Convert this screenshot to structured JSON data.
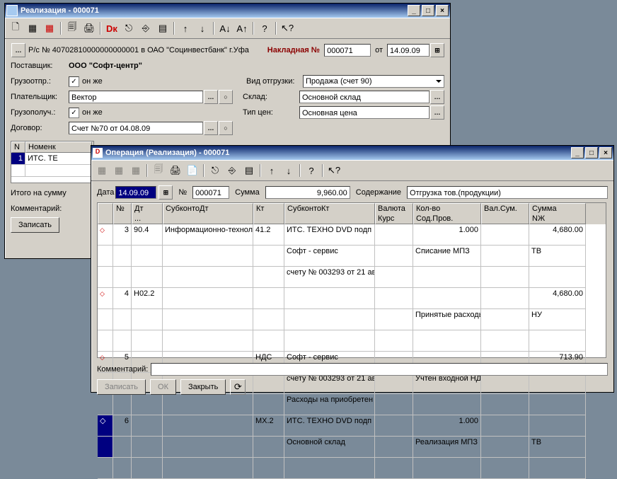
{
  "win1": {
    "title": "Реализация - 000071",
    "bank_line": "Р/с № 40702810000000000001 в ОАО \"Социнвестбанк\" г.Уфа",
    "invoice_label": "Накладная №",
    "invoice_no": "000071",
    "date_label": "от",
    "date": "14.09.09",
    "supplier_label": "Поставщик:",
    "supplier": "ООО \"Софт-центр\"",
    "shipper_label": "Грузоотпр.:",
    "same": "он же",
    "payer_label": "Плательщик:",
    "payer": "Вектор",
    "consignee_label": "Грузополуч.:",
    "contract_label": "Договор:",
    "contract": "Счет №70 от 04.08.09",
    "shiptype_label": "Вид отгрузки:",
    "shiptype": "Продажа (счет 90)",
    "warehouse_label": "Склад:",
    "warehouse": "Основной склад",
    "pricetype_label": "Тип цен:",
    "pricetype": "Основная цена",
    "grid_cols": {
      "n": "N",
      "nomenklatura": "Номенк"
    },
    "grid_row1_n": "1",
    "grid_row1_text": "ИТС. ТЕ",
    "total_label": "Итого на сумму",
    "comment_label": "Комментарий:",
    "save_btn": "Записать"
  },
  "win2": {
    "title": "Операция (Реализация) - 000071",
    "date_label": "Дата",
    "date": "14.09.09",
    "no_label": "№",
    "no": "000071",
    "sum_label": "Сумма",
    "sum": "9,960.00",
    "content_label": "Содержание",
    "content": "Отгрузка тов.(продукции)",
    "cols": {
      "mark": "",
      "n": "№",
      "dt": "Дт",
      "subdt": "СубконтоДт",
      "kt": "Кт",
      "subkt": "СубконтоКт",
      "curr": "Валюта",
      "rate": "Курс",
      "qty": "Кол-во",
      "sod": "Сод.Пров.",
      "valsum": "Вал.Сум.",
      "sum": "Сумма",
      "nzh": "NЖ"
    },
    "rows": [
      {
        "n": "3",
        "dt": "90.4",
        "subdt": "Информационно-технол",
        "kt": "41.2",
        "subkt1": "ИТС. ТЕХНО DVD подп",
        "subkt2": "Софт - сервис",
        "subkt3": "счету № 003293 от 21 ав",
        "qty": "1.000",
        "sod": "Списание МПЗ",
        "sum": "4,680.00",
        "nzh": "ТВ"
      },
      {
        "n": "4",
        "dt": "Н02.2",
        "subdt": "",
        "kt": "",
        "subkt1": "",
        "subkt2": "",
        "subkt3": "",
        "qty": "",
        "sod": "Принятые расходы",
        "sum": "4,680.00",
        "nzh": "НУ"
      },
      {
        "n": "5",
        "dt": "",
        "subdt": "",
        "kt": "НДС",
        "subkt1": "Софт - сервис",
        "subkt2": "счету № 003293 от 21 ав",
        "subkt3": "Расходы на приобретен",
        "qty": "",
        "sod": "Учтен входной НДС",
        "sum": "713.90",
        "nzh": ""
      },
      {
        "n": "6",
        "dt": "",
        "subdt": "",
        "kt": "МХ.2",
        "subkt1": "ИТС. ТЕХНО DVD подп",
        "subkt2": "Основной склад",
        "subkt3": "",
        "qty": "1.000",
        "sod": "Реализация МПЗ",
        "sum": "",
        "nzh": "ТВ"
      }
    ],
    "comment_label": "Комментарий:",
    "btn_save": "Записать",
    "btn_ok": "ОК",
    "btn_close": "Закрыть"
  }
}
